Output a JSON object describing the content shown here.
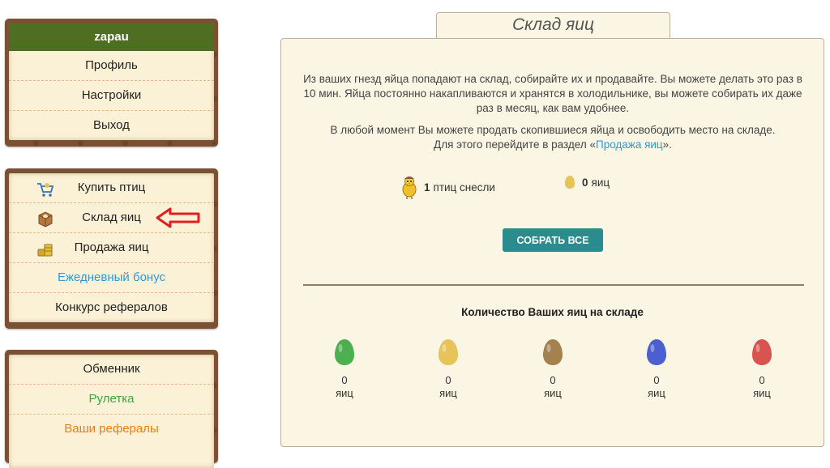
{
  "user_panel": {
    "username": "zapau",
    "items": [
      {
        "label": "Профиль"
      },
      {
        "label": "Настройки"
      },
      {
        "label": "Выход"
      }
    ]
  },
  "shop_panel": {
    "items": [
      {
        "label": "Купить птиц",
        "icon": "cart-bird-icon"
      },
      {
        "label": "Склад яиц",
        "icon": "egg-box-icon"
      },
      {
        "label": "Продажа яиц",
        "icon": "gold-coins-icon"
      },
      {
        "label": "Ежедневный бонус",
        "color": "#2d9ad8"
      },
      {
        "label": "Конкурс рефералов"
      }
    ]
  },
  "extra_panel": {
    "items": [
      {
        "label": "Обменник"
      },
      {
        "label": "Рулетка",
        "color": "#3aa73a"
      },
      {
        "label": "Ваши рефералы",
        "color": "#f07c12"
      }
    ]
  },
  "page": {
    "tab_title": "Склад яиц",
    "intro_text": "Из ваших гнезд яйца попадают на склад, собирайте их и продавайте. Вы можете делать это раз в 10 мин. Яйца постоянно накапливаются и хранятся в холодильнике, вы можете собирать их даже раз в месяц, как вам удобнее.",
    "sell_line1": "В любой момент Вы можете продать скопившиеся яйца и освободить место на складе.",
    "sell_line2_prefix": "Для этого перейдите в раздел «",
    "sell_link": "Продажа яиц",
    "sell_line2_suffix": "».",
    "birds_count": "1",
    "birds_label": "птиц снесли",
    "eggs_count": "0",
    "eggs_label": "яиц",
    "collect_button": "Собрать все",
    "count_title": "Количество Ваших яиц на складе",
    "eggs": [
      {
        "color": "#4caf50",
        "count": "0",
        "unit": "яиц"
      },
      {
        "color": "#e8c35a",
        "count": "0",
        "unit": "яиц"
      },
      {
        "color": "#a5814f",
        "count": "0",
        "unit": "яиц"
      },
      {
        "color": "#4a5fd0",
        "count": "0",
        "unit": "яиц"
      },
      {
        "color": "#d9534f",
        "count": "0",
        "unit": "яиц"
      }
    ]
  },
  "colors": {
    "panel_frame": "#7a5233",
    "panel_bg": "#fbf1d6",
    "header_green": "#4e6f22",
    "button_teal": "#2a8c8c",
    "arrow_red": "#e02020"
  }
}
